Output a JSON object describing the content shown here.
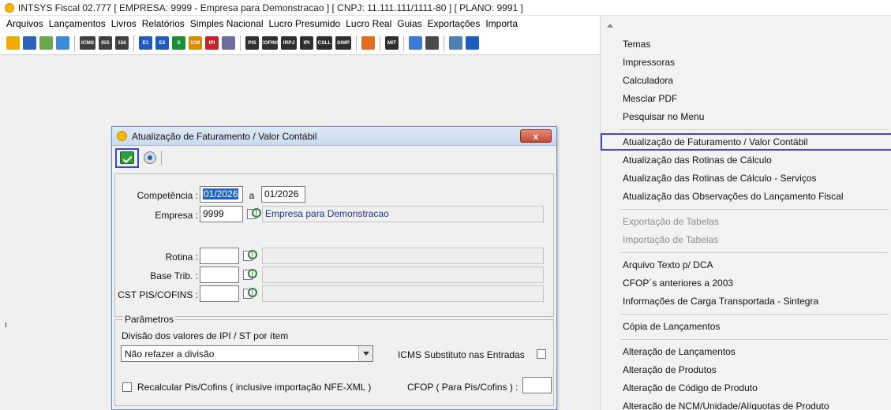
{
  "window": {
    "title": "INTSYS Fiscal 02.777 [ EMPRESA: 9999 - Empresa para Demonstracao ] [ CNPJ: 11.111.111/1111-80 ] [ PLANO: 9991 ]"
  },
  "menubar": {
    "items": [
      "Arquivos",
      "Lançamentos",
      "Livros",
      "Relatórios",
      "Simples Nacional",
      "Lucro Presumido",
      "Lucro Real",
      "Guias",
      "Exportações",
      "Importa"
    ]
  },
  "toolbar": {
    "buttons": [
      {
        "icon": "star-icon",
        "label": "",
        "color": "#f2a900"
      },
      {
        "icon": "people-icon",
        "label": "",
        "color": "#2d63b8"
      },
      {
        "icon": "building-icon",
        "label": "",
        "color": "#6aa84f"
      },
      {
        "icon": "screen-icon",
        "label": "",
        "color": "#3b8bd6"
      },
      {
        "sep": true
      },
      {
        "icon": "icms-icon",
        "label": "ICMS",
        "color": "#3f3f3f"
      },
      {
        "icon": "iss-icon",
        "label": "ISS",
        "color": "#3f3f3f"
      },
      {
        "icon": "iss-156-icon",
        "label": "156",
        "color": "#3f3f3f"
      },
      {
        "sep": true
      },
      {
        "icon": "e1-icon",
        "label": "E1",
        "color": "#1f5bbf"
      },
      {
        "icon": "e2-icon",
        "label": "E2",
        "color": "#1f5bbf"
      },
      {
        "icon": "s-icon",
        "label": "S",
        "color": "#1b8e35"
      },
      {
        "icon": "icm-icon",
        "label": "ICM",
        "color": "#e08a00"
      },
      {
        "icon": "ipi-icon",
        "label": "IPI",
        "color": "#c4232c"
      },
      {
        "icon": "book-icon",
        "label": "",
        "color": "#6d6d9f"
      },
      {
        "sep": true
      },
      {
        "icon": "pis-icon",
        "label": "PIS",
        "color": "#2f2f2f"
      },
      {
        "icon": "cofins-icon",
        "label": "COFINS",
        "color": "#2f2f2f"
      },
      {
        "icon": "irpj-icon",
        "label": "IRPJ",
        "color": "#2f2f2f"
      },
      {
        "icon": "ipi-small-icon",
        "label": "IPI",
        "color": "#2f2f2f"
      },
      {
        "icon": "csll-icon",
        "label": "CSLL",
        "color": "#2f2f2f"
      },
      {
        "icon": "simp-icon",
        "label": "SIMP",
        "color": "#2f2f2f"
      },
      {
        "sep": true
      },
      {
        "icon": "swirl-icon",
        "label": "",
        "color": "#e46b1f"
      },
      {
        "sep": true
      },
      {
        "icon": "mit-icon",
        "label": "MIT",
        "color": "#2f2f2f"
      },
      {
        "sep": true
      },
      {
        "icon": "report-icon",
        "label": "",
        "color": "#3a7bd5"
      },
      {
        "icon": "calculator-icon",
        "label": "",
        "color": "#4a4a4a"
      },
      {
        "sep": true
      },
      {
        "icon": "monitor-icon",
        "label": "",
        "color": "#4f7fb4"
      },
      {
        "icon": "help-icon",
        "label": "",
        "color": "#1a5fc0"
      }
    ]
  },
  "dialog": {
    "title": "Atualização de Faturamento / Valor Contábil",
    "close_label": "x",
    "competencia_label": "Competência :",
    "competencia_from": "01/2026",
    "competencia_sep": "a",
    "competencia_to": "01/2026",
    "empresa_label": "Empresa :",
    "empresa_code": "9999",
    "empresa_name": "Empresa para Demonstracao",
    "rotina_label": "Rotina :",
    "base_label": "Base Trib. :",
    "cst_label": "CST PIS/COFINS :",
    "params_title": "Parâmetros",
    "divisao_label": "Divisão dos valores de IPI / ST por ítem",
    "divisao_value": "Não refazer a divisão",
    "icms_subst_label": "ICMS Substituto nas Entradas",
    "recalcular_label": "Recalcular Pis/Cofins ( inclusive importação NFE-XML )",
    "cfop_label": "CFOP ( Para Pis/Cofins ) :",
    "cfop_value": ""
  },
  "left_edge_text": "ı",
  "dropdown_menu": {
    "items": [
      {
        "label": "Temas",
        "state": "normal"
      },
      {
        "label": "Impressoras",
        "state": "normal"
      },
      {
        "label": "Calculadora",
        "state": "normal"
      },
      {
        "label": "Mesclar PDF",
        "state": "normal"
      },
      {
        "label": "Pesquisar no Menu",
        "state": "normal"
      },
      {
        "sep": true
      },
      {
        "label": "Atualização de Faturamento / Valor Contábil",
        "state": "highlighted"
      },
      {
        "label": "Atualização das Rotinas de Cálculo",
        "state": "normal"
      },
      {
        "label": "Atualização das Rotinas de Cálculo - Serviços",
        "state": "normal"
      },
      {
        "label": "Atualização das Observações do Lançamento Fiscal",
        "state": "normal"
      },
      {
        "sep": true
      },
      {
        "label": "Exportação de Tabelas",
        "state": "disabled"
      },
      {
        "label": "Importação de Tabelas",
        "state": "disabled"
      },
      {
        "sep": true
      },
      {
        "label": "Arquivo Texto p/ DCA",
        "state": "normal"
      },
      {
        "label": "CFOP´s anteriores a 2003",
        "state": "normal"
      },
      {
        "label": "Informações de Carga Transportada  -  Sintegra",
        "state": "normal"
      },
      {
        "sep": true
      },
      {
        "label": "Cópia de Lançamentos",
        "state": "normal"
      },
      {
        "sep": true
      },
      {
        "label": "Alteração de Lançamentos",
        "state": "normal"
      },
      {
        "label": "Alteração de Produtos",
        "state": "normal"
      },
      {
        "label": "Alteração de Código de Produto",
        "state": "normal"
      },
      {
        "label": "Alteração de NCM/Unidade/Alíquotas de Produto",
        "state": "normal"
      }
    ]
  }
}
